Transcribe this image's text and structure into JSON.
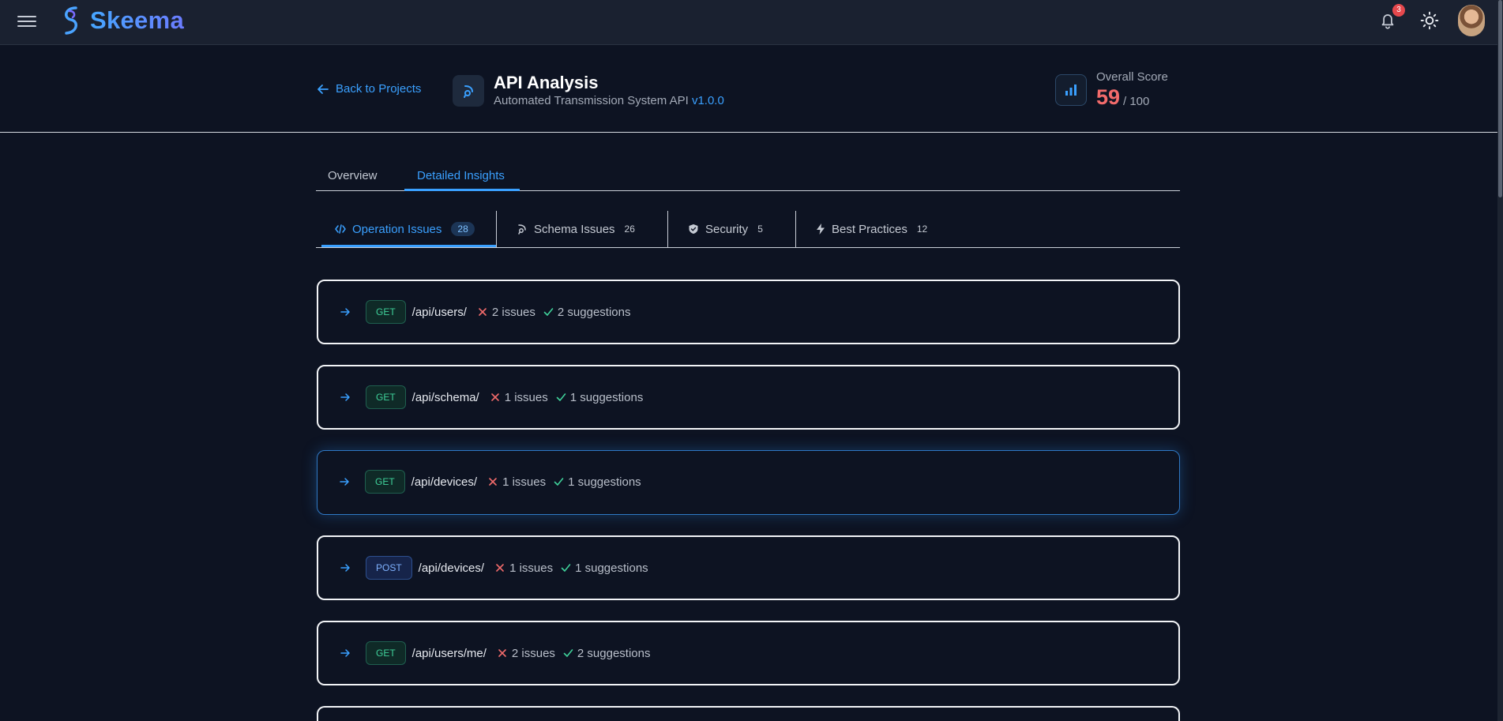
{
  "app": {
    "name": "Skeema",
    "notification_count": "3"
  },
  "header": {
    "back_label": "Back to Projects",
    "title": "API Analysis",
    "subtitle": "Automated Transmission System API",
    "version": "v1.0.0",
    "score_label": "Overall Score",
    "score_value": "59",
    "score_max": "/ 100"
  },
  "tabs": [
    {
      "label": "Overview",
      "active": false
    },
    {
      "label": "Detailed Insights",
      "active": true
    }
  ],
  "subtabs": [
    {
      "label": "Operation Issues",
      "count": "28",
      "icon": "code-icon",
      "active": true
    },
    {
      "label": "Schema Issues",
      "count": "26",
      "icon": "schema-icon",
      "active": false
    },
    {
      "label": "Security",
      "count": "5",
      "icon": "shield-icon",
      "active": false
    },
    {
      "label": "Best Practices",
      "count": "12",
      "icon": "bolt-icon",
      "active": false
    }
  ],
  "operations": [
    {
      "method": "GET",
      "path": "/api/users/",
      "issues": "2 issues",
      "suggestions": "2 suggestions"
    },
    {
      "method": "GET",
      "path": "/api/schema/",
      "issues": "1 issues",
      "suggestions": "1 suggestions"
    },
    {
      "method": "GET",
      "path": "/api/devices/",
      "issues": "1 issues",
      "suggestions": "1 suggestions"
    },
    {
      "method": "POST",
      "path": "/api/devices/",
      "issues": "1 issues",
      "suggestions": "1 suggestions"
    },
    {
      "method": "GET",
      "path": "/api/users/me/",
      "issues": "2 issues",
      "suggestions": "2 suggestions"
    }
  ],
  "colors": {
    "accent": "#3aa0ff",
    "score": "#f26b6b",
    "get": "#3fd19a",
    "post": "#7fb2ff",
    "error": "#f26b6b",
    "success": "#3fd19a"
  }
}
